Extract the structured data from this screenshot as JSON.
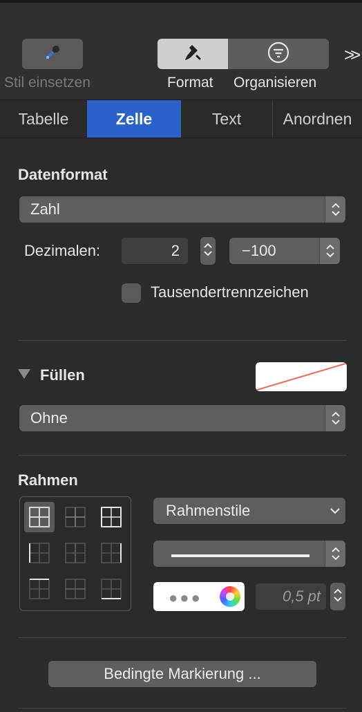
{
  "toolbar": {
    "stil_label": "Stil einsetzen",
    "format_label": "Format",
    "organisieren_label": "Organisieren",
    "more_glyph": ">>"
  },
  "tabs": [
    {
      "label": "Tabelle",
      "active": false
    },
    {
      "label": "Zelle",
      "active": true
    },
    {
      "label": "Text",
      "active": false
    },
    {
      "label": "Anordnen",
      "active": false
    }
  ],
  "datenformat": {
    "heading": "Datenformat",
    "format_value": "Zahl",
    "dezimalen_label": "Dezimalen:",
    "dezimalen_value": "2",
    "negative_value": "−100",
    "tausender_label": "Tausendertrennzeichen",
    "tausender_checked": false
  },
  "fuellen": {
    "heading": "Füllen",
    "fill_value": "Ohne"
  },
  "rahmen": {
    "heading": "Rahmen",
    "stile_value": "Rahmenstile",
    "width_value": "0,5 pt"
  },
  "bedingte_label": "Bedingte Markierung ...",
  "colors": {
    "accent": "#2a62c9",
    "background": "#2b2b2b",
    "no_fill_line": "#e0705a"
  }
}
